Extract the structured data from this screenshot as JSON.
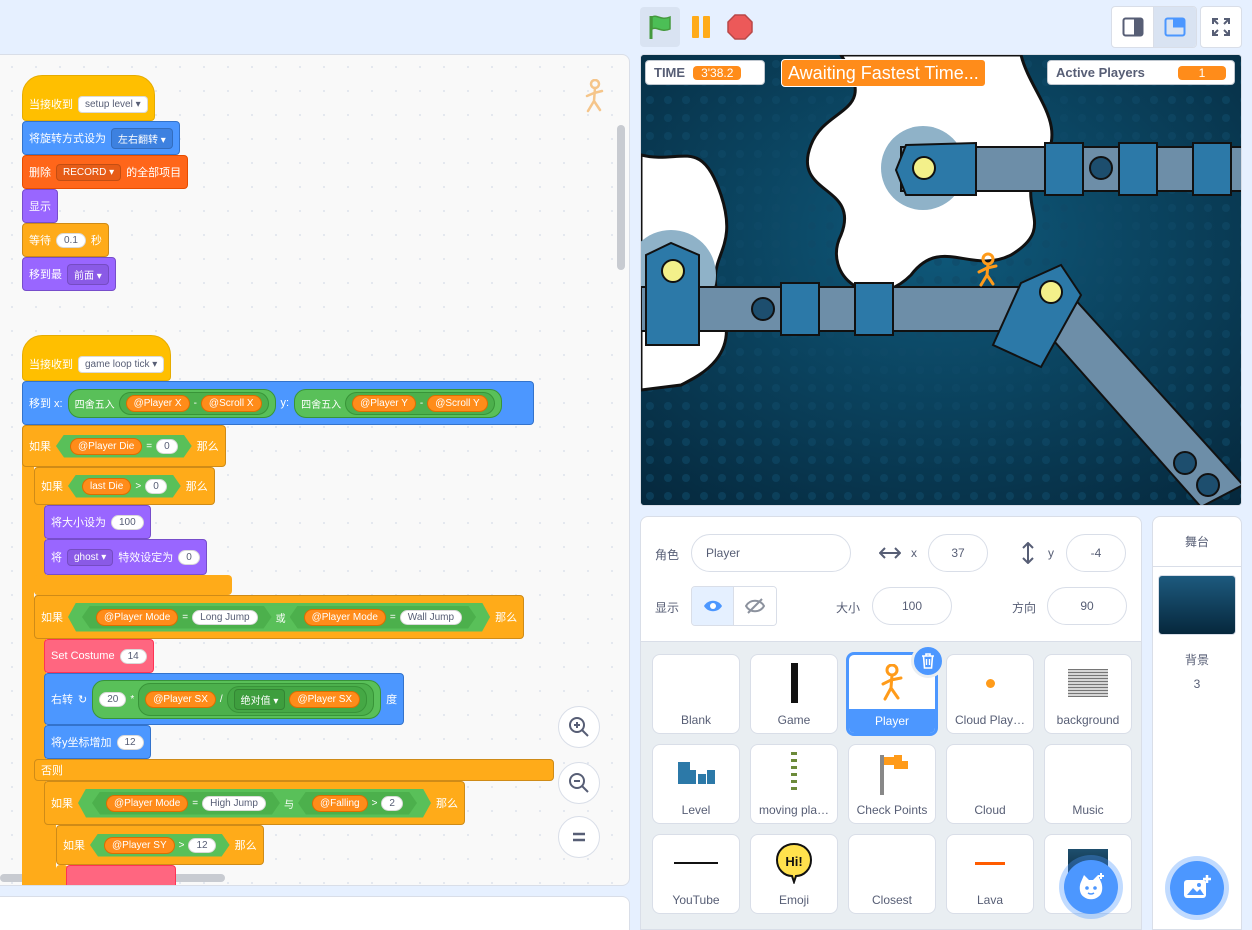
{
  "controls": {
    "green_flag": "green-flag-icon",
    "pause": "pause-icon",
    "stop": "stop-icon",
    "small_stage": "small-stage-icon",
    "normal_stage": "normal-stage-icon",
    "fullscreen": "fullscreen-icon"
  },
  "script1": {
    "hat_label": "当接收到",
    "hat_msg": "setup level",
    "rot_label": "将旋转方式设为",
    "rot_value": "左右翻转",
    "delete_label": "删除",
    "delete_list": "RECORD",
    "delete_suffix": "的全部项目",
    "show_label": "显示",
    "wait_label": "等待",
    "wait_value": "0.1",
    "wait_unit": "秒",
    "layer_label": "移到最",
    "layer_value": "前面"
  },
  "script2": {
    "hat_label": "当接收到",
    "hat_msg": "game loop tick",
    "goto_label": "移到 x:",
    "round1": "四舍五入",
    "player_x": "@Player X",
    "minus": "-",
    "scroll_x": "@Scroll X",
    "y_label": "y:",
    "round2": "四舍五入",
    "player_y": "@Player Y",
    "minus2": "-",
    "scroll_y": "@Scroll Y",
    "if1_label": "如果",
    "player_die": "@Player Die",
    "eq": "=",
    "zero": "0",
    "then": "那么",
    "if2_label": "如果",
    "last_die": "last Die",
    "gt": ">",
    "zero2": "0",
    "then2": "那么",
    "size_label": "将大小设为",
    "size_value": "100",
    "effect_label": "将",
    "effect_name": "ghost",
    "effect_suffix": "特效设定为",
    "effect_value": "0",
    "if3_label": "如果",
    "player_mode": "@Player Mode",
    "eq2": "=",
    "long_jump": "Long Jump",
    "or": "或",
    "player_mode2": "@Player Mode",
    "eq3": "=",
    "wall_jump": "Wall Jump",
    "then3": "那么",
    "costume_label": "Set Costume",
    "costume_value": "14",
    "turn_label": "右转",
    "turn_value": "20",
    "times": "*",
    "player_sx": "@Player SX",
    "div": "/",
    "abs_label": "绝对值",
    "player_sx2": "@Player SX",
    "deg": "度",
    "change_y_label": "将y坐标增加",
    "change_y_value": "12",
    "else_label": "否则",
    "if4_label": "如果",
    "player_mode3": "@Player Mode",
    "eq4": "=",
    "high_jump": "High Jump",
    "and": "与",
    "falling": "@Falling",
    "gt2": ">",
    "two": "2",
    "then4": "那么",
    "if5_label": "如果",
    "player_sy": "@Player SY",
    "gt3": ">",
    "twelve": "12",
    "then5": "那么"
  },
  "stage": {
    "time_label": "TIME",
    "time_value": "3'38.2",
    "banner": "Awaiting Fastest Time...",
    "active_label": "Active Players",
    "active_value": "1"
  },
  "sprite_info": {
    "sprite_label": "角色",
    "sprite_name": "Player",
    "x_label": "x",
    "x_value": "37",
    "y_label": "y",
    "y_value": "-4",
    "show_label": "显示",
    "size_label": "大小",
    "size_value": "100",
    "direction_label": "方向",
    "direction_value": "90"
  },
  "sprites": [
    {
      "name": "Blank",
      "icon": "blank-icon"
    },
    {
      "name": "Game",
      "icon": "bar-icon"
    },
    {
      "name": "Player",
      "icon": "stickman-icon"
    },
    {
      "name": "Cloud Play…",
      "icon": "dot-icon"
    },
    {
      "name": "background",
      "icon": "grid-icon"
    },
    {
      "name": "Level",
      "icon": "level-icon"
    },
    {
      "name": "moving pla…",
      "icon": "chain-icon"
    },
    {
      "name": "Check Points",
      "icon": "flag-icon"
    },
    {
      "name": "Cloud",
      "icon": "blank-icon"
    },
    {
      "name": "Music",
      "icon": "blank-icon"
    },
    {
      "name": "YouTube",
      "icon": "line-icon"
    },
    {
      "name": "Emoji",
      "icon": "hi-bubble-icon"
    },
    {
      "name": "Closest",
      "icon": "blank-icon"
    },
    {
      "name": "Lava",
      "icon": "lava-icon"
    },
    {
      "name": "",
      "icon": "backdrop-thumb-icon"
    }
  ],
  "stage_target": {
    "title": "舞台",
    "backdrops_label": "背景",
    "backdrops_count": "3"
  },
  "bubble_text": "Hi!"
}
